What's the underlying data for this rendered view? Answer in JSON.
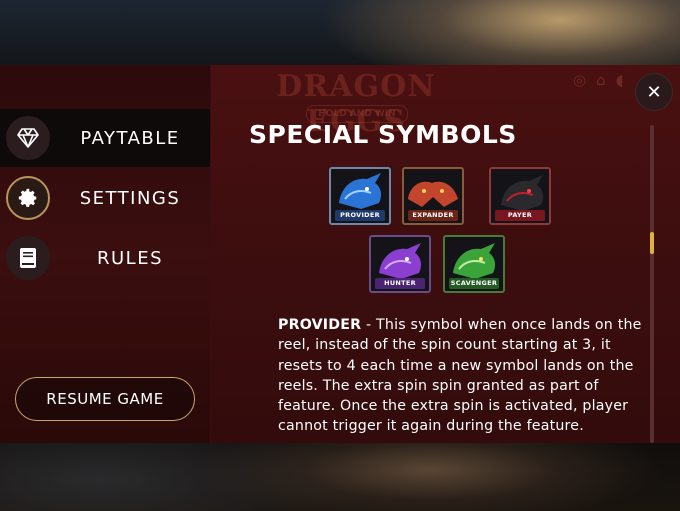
{
  "game": {
    "logo": "DRAGON EGGS",
    "logo_sub": "HOLD AND WIN"
  },
  "menu": {
    "items": [
      {
        "label": "PAYTABLE",
        "icon": "diamond-icon",
        "active": true
      },
      {
        "label": "SETTINGS",
        "icon": "gear-icon",
        "active": false
      },
      {
        "label": "RULES",
        "icon": "book-icon",
        "active": false
      }
    ],
    "resume_label": "RESUME GAME"
  },
  "panel": {
    "heading": "SPECIAL SYMBOLS",
    "symbols": [
      {
        "name": "PROVIDER",
        "color": "#2a74d6"
      },
      {
        "name": "EXPANDER",
        "color": "#c2452c"
      },
      {
        "name": "PAYER",
        "color": "#c01e2a"
      },
      {
        "name": "HUNTER",
        "color": "#8a3fd0"
      },
      {
        "name": "SCAVENGER",
        "color": "#3aa43a"
      }
    ],
    "description_title": "PROVIDER",
    "description_text": " - This symbol when once lands on the reel, instead of the spin count starting at 3, it resets to 4 each time a new symbol lands on the reels. The extra spin spin granted as part of feature. Once the extra spin is activated, player cannot trigger it again during the feature.",
    "close_glyph": "✕"
  },
  "colors": {
    "accent_gold": "#c9a868",
    "scroll_thumb": "#e0b23d",
    "panel_bg": "#3f0e0f"
  }
}
